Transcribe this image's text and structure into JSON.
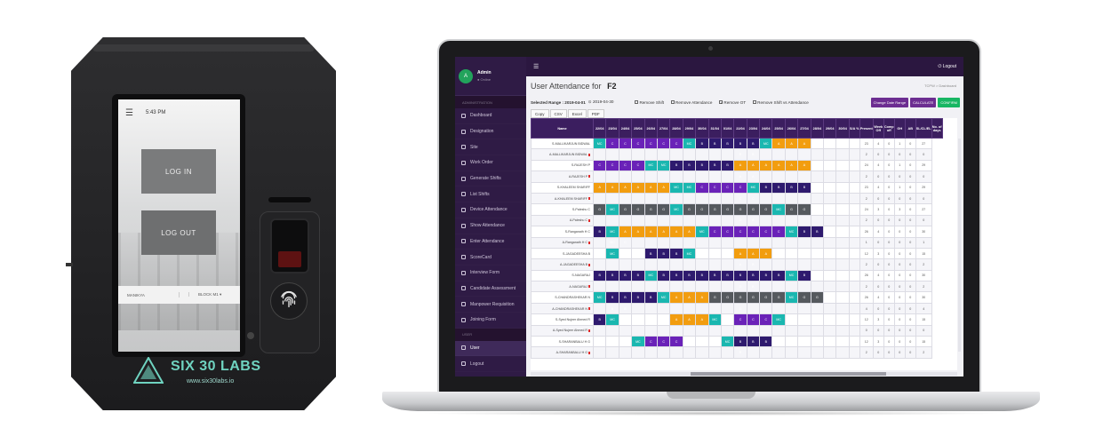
{
  "device": {
    "time": "5:43 PM",
    "login_label": "LOG IN",
    "logout_label": "LOG OUT",
    "bottom_left": "MANIKYA",
    "bottom_right": "BLOCK M1",
    "brand_name": "SIX 30 LABS",
    "brand_url": "www.six30labs.io"
  },
  "app": {
    "logout_label": "Logout",
    "user": {
      "avatar": "A",
      "name": "Admin",
      "status": "Online"
    },
    "section_admin": "ADMINISTRATION",
    "section_user": "USER",
    "sidebar_items": [
      "Dashboard",
      "Designation",
      "Site",
      "Work Order",
      "Generate Shifts",
      "List Shifts",
      "Device Attendance",
      "Show Attendance",
      "Enter Attendance",
      "ScoreCard",
      "Interview Form",
      "Candidate Assessment",
      "Manpower Requisition",
      "Joining Form"
    ],
    "sidebar_user_items": [
      "User",
      "Logout"
    ],
    "title_prefix": "User Attendance for",
    "title_site": "F2",
    "breadcrumb": "TCPW  >  Dashboard",
    "range_label": "Selected Range : 2019-04-01",
    "range_end": "2019-04-30",
    "checkboxes": [
      "Remove Shift",
      "Remove Attendance",
      "Remove OT",
      "Remove Shift vs Attendance"
    ],
    "buttons": {
      "change_range": "Change Date Range",
      "calculate": "CALCULATE",
      "confirm": "CONFIRM"
    },
    "export_buttons": [
      "Copy",
      "CSV",
      "Excel",
      "PDF"
    ],
    "table_headers": {
      "name": "Name",
      "dates": [
        "22/04",
        "23/04",
        "24/04",
        "25/04",
        "26/04",
        "27/04",
        "28/04",
        "29/04",
        "30/04",
        "31/04",
        "01/04",
        "22/04",
        "23/04",
        "24/04",
        "25/04",
        "26/04",
        "27/04",
        "28/04",
        "29/04",
        "30/04"
      ],
      "summary": [
        "S/A %",
        "Present",
        "Week Off",
        "Comp off",
        "GH",
        "AB",
        "SL/CL/EL",
        "No. of days"
      ]
    },
    "rows": [
      {
        "name": "S-MALLIKARJUN BIDWAL",
        "cells": [
          "MC",
          "C",
          "C",
          "C",
          "C",
          "C",
          "C",
          "MC",
          "B",
          "B",
          "B",
          "B",
          "B",
          "MC",
          "A",
          "A",
          "A",
          "",
          "",
          ""
        ],
        "summary": [
          "",
          "23",
          "4",
          "0",
          "1",
          "0",
          "27"
        ]
      },
      {
        "name": "A-MALLIKARJUN BIDWAL",
        "flag": true,
        "cells": [
          "",
          "",
          "",
          "",
          "",
          "",
          "",
          "",
          "",
          "",
          "",
          "B",
          "B",
          "",
          "",
          "",
          "",
          "",
          "",
          ""
        ],
        "summary": [
          "",
          "2",
          "0",
          "0",
          "0",
          "0",
          "0"
        ]
      },
      {
        "name": "S-RAJESH P",
        "cells": [
          "C",
          "C",
          "C",
          "C",
          "MC",
          "MC",
          "B",
          "B",
          "B",
          "B",
          "B",
          "A",
          "A",
          "A",
          "A",
          "A",
          "A",
          "",
          "",
          ""
        ],
        "summary": [
          "",
          "24",
          "4",
          "0",
          "1",
          "0",
          "29"
        ]
      },
      {
        "name": "A-RAJESH P",
        "flag": true,
        "cells": [
          "",
          "",
          "",
          "",
          "",
          "",
          "",
          "",
          "",
          "",
          "",
          "A",
          "A",
          "",
          "",
          "",
          "",
          "",
          "",
          ""
        ],
        "summary": [
          "",
          "2",
          "0",
          "0",
          "0",
          "0",
          "0"
        ]
      },
      {
        "name": "S-KHALEEM SHARIFF",
        "cells": [
          "A",
          "A",
          "A",
          "A",
          "A",
          "A",
          "MC",
          "MC",
          "C",
          "C",
          "C",
          "C",
          "MC",
          "B",
          "B",
          "B",
          "B",
          "",
          "",
          ""
        ],
        "summary": [
          "",
          "23",
          "4",
          "0",
          "1",
          "0",
          "29"
        ]
      },
      {
        "name": "A-KHALEEM SHARIFF",
        "flag": true,
        "cells": [
          "",
          "",
          "",
          "",
          "",
          "",
          "",
          "",
          "",
          "",
          "",
          "C",
          "C",
          "",
          "",
          "",
          "",
          "",
          "",
          ""
        ],
        "summary": [
          "",
          "2",
          "0",
          "0",
          "0",
          "0",
          "0"
        ]
      },
      {
        "name": "S-Paleshu C",
        "cells": [
          "G",
          "MC",
          "G",
          "G",
          "G",
          "G",
          "MC",
          "G",
          "G",
          "G",
          "G",
          "G",
          "G",
          "G",
          "MC",
          "G",
          "G",
          "",
          "",
          ""
        ],
        "summary": [
          "",
          "24",
          "3",
          "0",
          "3",
          "0",
          "27"
        ]
      },
      {
        "name": "A-Paleshu C",
        "flag": true,
        "cells": [
          "",
          "",
          "",
          "",
          "",
          "",
          "",
          "",
          "",
          "",
          "",
          "G",
          "A",
          "",
          "",
          "",
          "",
          "",
          "",
          ""
        ],
        "summary": [
          "",
          "2",
          "0",
          "0",
          "0",
          "0",
          "0"
        ]
      },
      {
        "name": "S-Ranganath H C",
        "cells": [
          "B",
          "MC",
          "A",
          "A",
          "A",
          "A",
          "A",
          "A",
          "MC",
          "C",
          "C",
          "C",
          "C",
          "C",
          "C",
          "MC",
          "B",
          "B",
          "",
          ""
        ],
        "summary": [
          "",
          "26",
          "4",
          "0",
          "0",
          "0",
          "30"
        ]
      },
      {
        "name": "A-Ranganath H C",
        "flag": true,
        "cells": [
          "",
          "MC",
          "C",
          "",
          "",
          "",
          "",
          "",
          "",
          "",
          "",
          "",
          "",
          "",
          "",
          "",
          "",
          "",
          "",
          ""
        ],
        "summary": [
          "",
          "1",
          "0",
          "0",
          "0",
          "0",
          "1"
        ]
      },
      {
        "name": "S-JAGADEESHA B",
        "cells": [
          "",
          "MC",
          "",
          "",
          "B",
          "B",
          "B",
          "MC",
          "",
          "",
          "",
          "A",
          "A",
          "A",
          "",
          "",
          "",
          "",
          "",
          ""
        ],
        "summary": [
          "",
          "12",
          "3",
          "0",
          "0",
          "0",
          "15"
        ]
      },
      {
        "name": "A-JAGADEESHA B",
        "flag": true,
        "cells": [
          "",
          "",
          "",
          "",
          "",
          "",
          "",
          "",
          "",
          "",
          "",
          "A",
          "B",
          "",
          "",
          "",
          "",
          "",
          "",
          ""
        ],
        "summary": [
          "",
          "2",
          "0",
          "0",
          "0",
          "0",
          "2"
        ]
      },
      {
        "name": "S-NAGARAJ",
        "cells": [
          "B",
          "B",
          "B",
          "B",
          "MC",
          "B",
          "B",
          "B",
          "B",
          "B",
          "B",
          "B",
          "B",
          "B",
          "B",
          "MC",
          "B",
          "",
          "",
          ""
        ],
        "summary": [
          "",
          "26",
          "4",
          "0",
          "0",
          "0",
          "30"
        ]
      },
      {
        "name": "A-NAGARAJ",
        "flag": true,
        "cells": [
          "",
          "",
          "",
          "",
          "",
          "",
          "",
          "",
          "",
          "",
          "",
          "G",
          "B",
          "",
          "",
          "",
          "",
          "",
          "",
          ""
        ],
        "summary": [
          "",
          "2",
          "0",
          "0",
          "0",
          "0",
          "2"
        ]
      },
      {
        "name": "S-CHANDRASHEKAR N",
        "cells": [
          "MC",
          "B",
          "B",
          "B",
          "B",
          "MC",
          "A",
          "A",
          "A",
          "G",
          "G",
          "G",
          "G",
          "G",
          "G",
          "MC",
          "G",
          "G",
          "",
          ""
        ],
        "summary": [
          "",
          "26",
          "4",
          "0",
          "0",
          "0",
          "30"
        ]
      },
      {
        "name": "A-CHANDRASHEKAR N",
        "flag": true,
        "cells": [
          "",
          "B",
          "B",
          "",
          "",
          "",
          "",
          "",
          "",
          "",
          "",
          "G",
          "",
          "",
          "",
          "",
          "",
          "",
          "",
          ""
        ],
        "summary": [
          "",
          "4",
          "0",
          "0",
          "0",
          "0",
          "4"
        ]
      },
      {
        "name": "S-Syed Nujeer Ahmed R",
        "cells": [
          "B",
          "MC",
          "",
          "",
          "",
          "",
          "A",
          "A",
          "A",
          "MC",
          "",
          "C",
          "C",
          "C",
          "MC",
          "",
          "",
          "",
          "",
          ""
        ],
        "summary": [
          "",
          "12",
          "3",
          "0",
          "0",
          "0",
          "15"
        ]
      },
      {
        "name": "A-Syed Nujeer Ahmed R",
        "flag": true,
        "cells": [
          "",
          "",
          "",
          "",
          "",
          "",
          "",
          "",
          "",
          "",
          "",
          "",
          "",
          "",
          "",
          "",
          "",
          "",
          "",
          ""
        ],
        "summary": [
          "",
          "0",
          "0",
          "0",
          "0",
          "0",
          "0"
        ]
      },
      {
        "name": "S-SHARANBALU H G",
        "cells": [
          "",
          "",
          "",
          "MC",
          "C",
          "C",
          "C",
          "",
          "",
          "",
          "MC",
          "B",
          "B",
          "B",
          "",
          "",
          "",
          "",
          "",
          ""
        ],
        "summary": [
          "",
          "12",
          "3",
          "0",
          "0",
          "0",
          "15"
        ]
      },
      {
        "name": "A-SHARANBALU H G",
        "flag": true,
        "cells": [
          "",
          "",
          "",
          "",
          "",
          "",
          "",
          "",
          "",
          "",
          "",
          "B",
          "",
          "",
          "",
          "",
          "",
          "",
          "",
          ""
        ],
        "summary": [
          "",
          "2",
          "0",
          "0",
          "0",
          "0",
          "2"
        ]
      }
    ],
    "colors": {
      "sidebar": "#2f1b45",
      "header": "#3b1e5f",
      "A": "#f29d0f",
      "B": "#2e1a6e",
      "C": "#6a22b8",
      "MC": "#1ab7b0",
      "G": "#55595e",
      "confirm": "#18b663"
    }
  }
}
